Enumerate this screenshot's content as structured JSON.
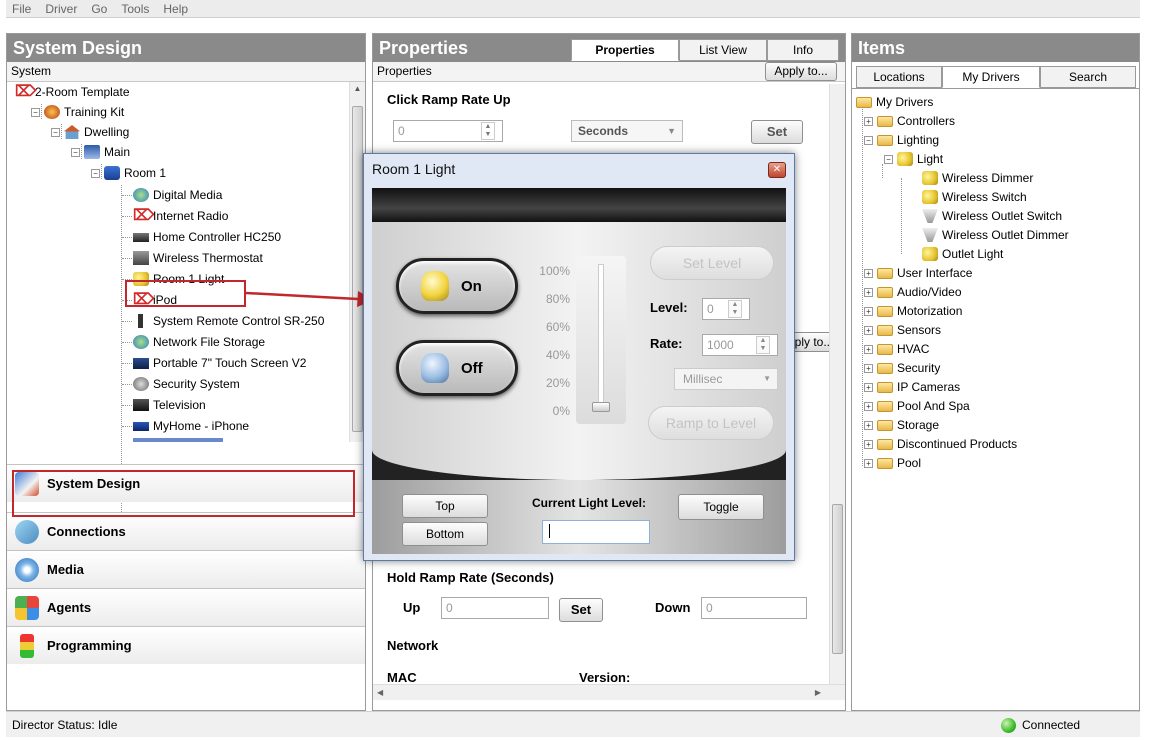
{
  "menu": [
    "File",
    "Driver",
    "Go",
    "Tools",
    "Help"
  ],
  "system_design": {
    "header": "System Design",
    "subheader": "System",
    "tree": [
      {
        "label": "2-Room Template",
        "icon": "control4-logo-icon"
      },
      {
        "label": "Training Kit",
        "icon": "project-icon"
      },
      {
        "label": "Dwelling",
        "icon": "house-icon"
      },
      {
        "label": "Main",
        "icon": "floor-icon"
      },
      {
        "label": "Room 1",
        "icon": "room-icon"
      },
      {
        "label": "Digital Media",
        "icon": "media-icon"
      },
      {
        "label": "Internet Radio",
        "icon": "control4-logo-icon"
      },
      {
        "label": "Home Controller HC250",
        "icon": "controller-icon"
      },
      {
        "label": "Wireless Thermostat",
        "icon": "thermostat-icon"
      },
      {
        "label": "Room 1 Light",
        "icon": "light-bulb-icon"
      },
      {
        "label": "iPod",
        "icon": "control4-logo-icon"
      },
      {
        "label": "System Remote Control SR-250",
        "icon": "remote-icon"
      },
      {
        "label": "Network File Storage",
        "icon": "media-icon"
      },
      {
        "label": "Portable 7\" Touch Screen V2",
        "icon": "touchscreen-icon"
      },
      {
        "label": "Security System",
        "icon": "security-icon"
      },
      {
        "label": "Television",
        "icon": "television-icon"
      },
      {
        "label": "MyHome - iPhone",
        "icon": "phone-icon"
      }
    ],
    "nav": [
      {
        "label": "System Design",
        "icon": "system-design-icon"
      },
      {
        "label": "Connections",
        "icon": "connections-icon"
      },
      {
        "label": "Media",
        "icon": "media-icon"
      },
      {
        "label": "Agents",
        "icon": "agents-icon"
      },
      {
        "label": "Programming",
        "icon": "traffic-light-icon"
      }
    ]
  },
  "properties": {
    "header": "Properties",
    "tabs": [
      "Properties",
      "List View",
      "Info"
    ],
    "subheader": "Properties",
    "apply_label": "Apply to...",
    "apply_label_2": "ply to...",
    "click_ramp": {
      "title": "Click Ramp Rate Up",
      "value": "0",
      "unit": "Seconds",
      "set": "Set"
    },
    "hold_ramp": {
      "title": "Hold Ramp Rate (Seconds)",
      "up_label": "Up",
      "up_value": "0",
      "set": "Set",
      "down_label": "Down",
      "down_value": "0"
    },
    "network": {
      "title": "Network",
      "mac_label": "MAC",
      "version_label": "Version:"
    }
  },
  "dialog": {
    "title": "Room 1 Light",
    "on_label": "On",
    "off_label": "Off",
    "percentages": [
      "100%",
      "80%",
      "60%",
      "40%",
      "20%",
      "0%"
    ],
    "slider_level": 0,
    "set_level": "Set Level",
    "level_label": "Level:",
    "level_value": "0",
    "rate_label": "Rate:",
    "rate_value": "1000",
    "rate_unit": "Millisec",
    "ramp_label": "Ramp to Level",
    "top_label": "Top",
    "bottom_label": "Bottom",
    "current_label": "Current Light Level:",
    "current_value": "",
    "toggle_label": "Toggle"
  },
  "items": {
    "header": "Items",
    "tabs": [
      "Locations",
      "My Drivers",
      "Search"
    ],
    "tree": [
      {
        "label": "My Drivers",
        "kind": "folder"
      },
      {
        "label": "Controllers",
        "kind": "folder"
      },
      {
        "label": "Lighting",
        "kind": "folder"
      },
      {
        "label": "Light",
        "kind": "light"
      },
      {
        "label": "Wireless Dimmer",
        "kind": "light"
      },
      {
        "label": "Wireless Switch",
        "kind": "light"
      },
      {
        "label": "Wireless Outlet Switch",
        "kind": "outlet"
      },
      {
        "label": "Wireless Outlet Dimmer",
        "kind": "outlet"
      },
      {
        "label": "Outlet Light",
        "kind": "light"
      },
      {
        "label": "User Interface",
        "kind": "folder"
      },
      {
        "label": "Audio/Video",
        "kind": "folder"
      },
      {
        "label": "Motorization",
        "kind": "folder"
      },
      {
        "label": "Sensors",
        "kind": "folder"
      },
      {
        "label": "HVAC",
        "kind": "folder"
      },
      {
        "label": "Security",
        "kind": "folder"
      },
      {
        "label": "IP Cameras",
        "kind": "folder"
      },
      {
        "label": "Pool And Spa",
        "kind": "folder"
      },
      {
        "label": "Storage",
        "kind": "folder"
      },
      {
        "label": "Discontinued Products",
        "kind": "folder"
      },
      {
        "label": "Pool",
        "kind": "folder"
      }
    ]
  },
  "status": {
    "left": "Director Status: Idle",
    "right": "Connected"
  },
  "colors": {
    "header_gray": "#8a8a8a",
    "highlight_red": "#c0282d",
    "connected_green": "#3cbb2a"
  }
}
